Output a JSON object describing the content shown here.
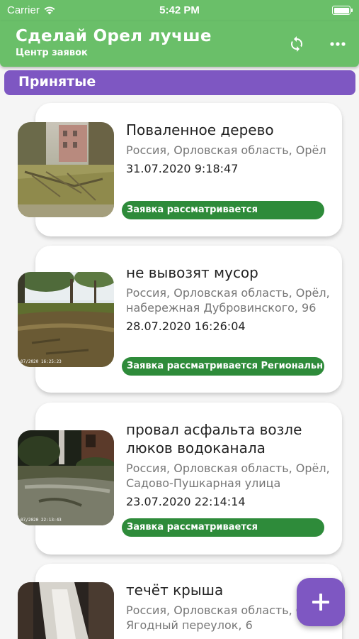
{
  "status_bar": {
    "carrier": "Carrier",
    "time": "5:42 PM"
  },
  "app_bar": {
    "title": "Сделай Орел лучше",
    "subtitle": "Центр заявок"
  },
  "section": {
    "title": "Принятые"
  },
  "requests": [
    {
      "title": "Поваленное дерево",
      "address": "Россия, Орловская область, Орёл",
      "date": "31.07.2020 9:18:47",
      "status": "Заявка рассматривается"
    },
    {
      "title": "не вывозят мусор",
      "address": "Россия, Орловская область, Орёл, набережная Дубровинского, 96",
      "date": "28.07.2020 16:26:04",
      "status": "Заявка рассматривается Региональн",
      "photo_stamp": "07/2020 16:25:23"
    },
    {
      "title": "провал асфальта возле люков водоканала",
      "address": "Россия, Орловская область, Орёл, Садово-Пушкарная улица",
      "date": "23.07.2020 22:14:14",
      "status": "Заявка рассматривается",
      "photo_stamp": "07/2020 22:13:43"
    },
    {
      "title": "течёт крыша",
      "address": "Россия, Орловская область, Орёл, Ягодный переулок, 6"
    }
  ],
  "colors": {
    "app_bar": "#6abf69",
    "section": "#7e57c2",
    "status": "#2e8b3a",
    "fab": "#7e57c2"
  }
}
